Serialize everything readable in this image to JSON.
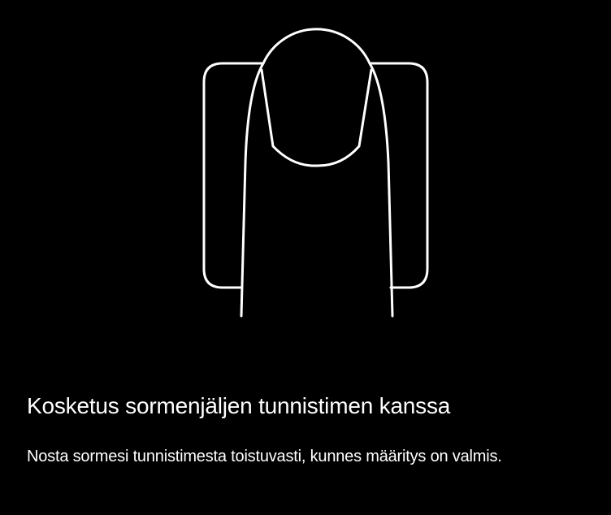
{
  "colors": {
    "background": "#000000",
    "foreground": "#ffffff"
  },
  "illustration": {
    "icon": "finger-on-fingerprint-sensor-icon"
  },
  "content": {
    "title": "Kosketus sormenjäljen tunnistimen kanssa",
    "description": "Nosta sormesi tunnistimesta toistuvasti, kunnes määritys on valmis."
  }
}
